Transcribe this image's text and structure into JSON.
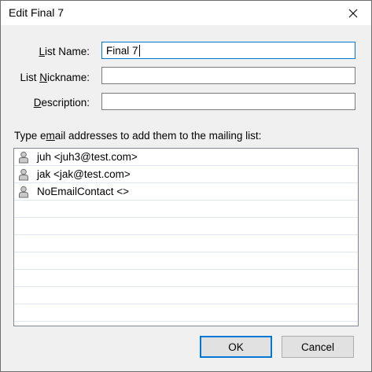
{
  "window": {
    "title": "Edit Final 7"
  },
  "fields": {
    "list_name": {
      "label_pre": "",
      "label_key": "L",
      "label_post": "ist Name:",
      "value": "Final 7"
    },
    "nickname": {
      "label_pre": "List ",
      "label_key": "N",
      "label_post": "ickname:",
      "value": ""
    },
    "description": {
      "label_pre": "",
      "label_key": "D",
      "label_post": "escription:",
      "value": ""
    }
  },
  "instruction": {
    "pre": "Type e",
    "key": "m",
    "post": "ail addresses to add them to the mailing list:"
  },
  "members": [
    {
      "text": "juh <juh3@test.com>",
      "icon": "contact-icon"
    },
    {
      "text": "jak <jak@test.com>",
      "icon": "contact-icon"
    },
    {
      "text": "NoEmailContact <>",
      "icon": "contact-icon"
    }
  ],
  "buttons": {
    "ok": "OK",
    "cancel": "Cancel"
  },
  "colors": {
    "accent": "#0078d7",
    "window_bg": "#f0f0f0",
    "row_divider": "#e1e5f0"
  }
}
